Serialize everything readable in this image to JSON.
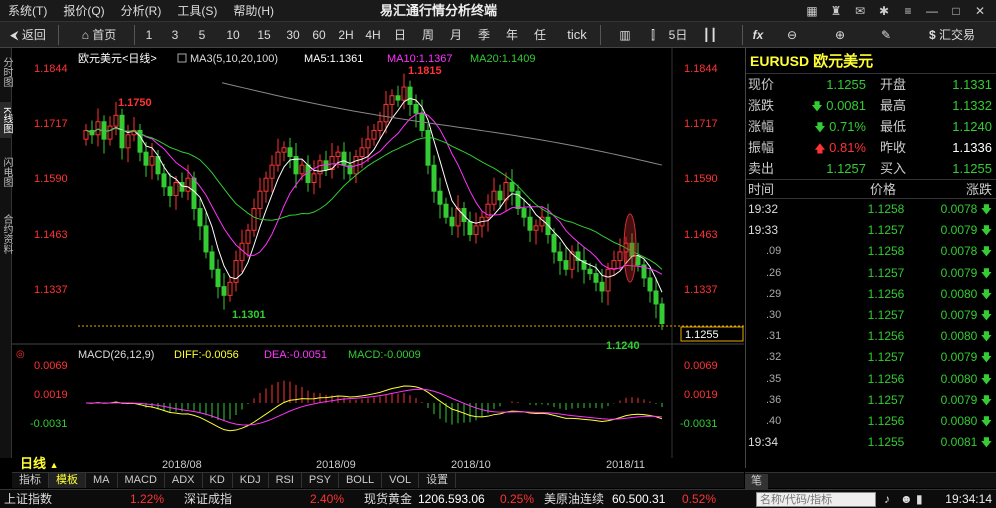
{
  "window": {
    "title": "易汇通行情分析终端",
    "menu": [
      "系统(T)",
      "报价(Q)",
      "分析(R)",
      "工具(S)",
      "帮助(H)"
    ]
  },
  "toolbar": {
    "back": "返回",
    "home": "首页",
    "periods": [
      "1",
      "3",
      "5",
      "10",
      "15",
      "30",
      "60",
      "2H",
      "4H",
      "日",
      "周",
      "月",
      "季",
      "年",
      "任",
      "tick"
    ],
    "five_day": "5日",
    "fx": "fx",
    "trade": "汇交易"
  },
  "left_tabs": [
    "分时图",
    "K线图",
    "闪电图",
    "合约资料"
  ],
  "chart_header": {
    "symbol": "欧元美元<日线>",
    "ma3": "MA3(5,10,20,100)",
    "ma5": "MA5:1.1361",
    "ma10": "MA10:1.1367",
    "ma20": "MA20:1.1409"
  },
  "price_axis": [
    "1.1844",
    "1.1717",
    "1.1590",
    "1.1463",
    "1.1337"
  ],
  "price_annotations": {
    "high": "1.1815",
    "left_high": "1.1750",
    "low": "1.1301",
    "recent_low": "1.1240",
    "current": "1.1255"
  },
  "macd_header": {
    "label": "MACD(26,12,9)",
    "diff": "DIFF:-0.0056",
    "dea": "DEA:-0.0051",
    "macd": "MACD:-0.0009"
  },
  "macd_axis": [
    "0.0069",
    "0.0019",
    "-0.0031"
  ],
  "date_axis": [
    "2018/08",
    "2018/09",
    "2018/10",
    "2018/11"
  ],
  "period_label": "日线",
  "bottom_tabs": [
    "指标",
    "模板",
    "MA",
    "MACD",
    "ADX",
    "KD",
    "KDJ",
    "RSI",
    "PSY",
    "BOLL",
    "VOL",
    "设置"
  ],
  "right_panel": {
    "code": "EURUSD",
    "name": "欧元美元",
    "quote": [
      {
        "l1": "现价",
        "v1": "1.1255",
        "c1": "green",
        "l2": "开盘",
        "v2": "1.1331",
        "c2": "green"
      },
      {
        "l1": "涨跌",
        "v1": "0.0081",
        "c1": "green",
        "a1": "down",
        "l2": "最高",
        "v2": "1.1332",
        "c2": "green"
      },
      {
        "l1": "涨幅",
        "v1": "0.71%",
        "c1": "green",
        "a1": "down",
        "l2": "最低",
        "v2": "1.1240",
        "c2": "green"
      },
      {
        "l1": "振幅",
        "v1": "0.81%",
        "c1": "red",
        "a1": "up",
        "l2": "昨收",
        "v2": "1.1336",
        "c2": "white"
      },
      {
        "l1": "卖出",
        "v1": "1.1257",
        "c1": "green",
        "l2": "买入",
        "v2": "1.1255",
        "c2": "green"
      }
    ],
    "tick_header": {
      "time": "时间",
      "price": "价格",
      "change": "涨跌"
    },
    "ticks": [
      {
        "t": "19:32",
        "p": "1.1258",
        "c": "0.0078"
      },
      {
        "t": "19:33",
        "p": "1.1257",
        "c": "0.0079"
      },
      {
        "t": ".09",
        "p": "1.1258",
        "c": "0.0078"
      },
      {
        "t": ".26",
        "p": "1.1257",
        "c": "0.0079"
      },
      {
        "t": ".29",
        "p": "1.1256",
        "c": "0.0080"
      },
      {
        "t": ".30",
        "p": "1.1257",
        "c": "0.0079"
      },
      {
        "t": ".31",
        "p": "1.1256",
        "c": "0.0080"
      },
      {
        "t": ".32",
        "p": "1.1257",
        "c": "0.0079"
      },
      {
        "t": ".35",
        "p": "1.1256",
        "c": "0.0080"
      },
      {
        "t": ".36",
        "p": "1.1257",
        "c": "0.0079"
      },
      {
        "t": ".40",
        "p": "1.1256",
        "c": "0.0080"
      },
      {
        "t": "19:34",
        "p": "1.1255",
        "c": "0.0081"
      }
    ],
    "footer_tab": "笔"
  },
  "status_bar": {
    "items": [
      {
        "name": "上证指数",
        "value": "",
        "pct": "1.22%"
      },
      {
        "name": "深证成指",
        "value": "",
        "pct": "2.40%"
      },
      {
        "name": "现货黄金",
        "value": "1206.593.06",
        "pct": "0.25%"
      },
      {
        "name": "美原油连续",
        "value": "60.500.31",
        "pct": "0.52%"
      }
    ],
    "search_placeholder": "名称/代码/指标",
    "time": "19:34:14"
  },
  "colors": {
    "up": "#ff3333",
    "down": "#33cc33",
    "ma5": "#ffffff",
    "ma10": "#ff33ff",
    "ma20": "#33cc33",
    "ma100": "#888888",
    "accent": "#ffff33"
  }
}
